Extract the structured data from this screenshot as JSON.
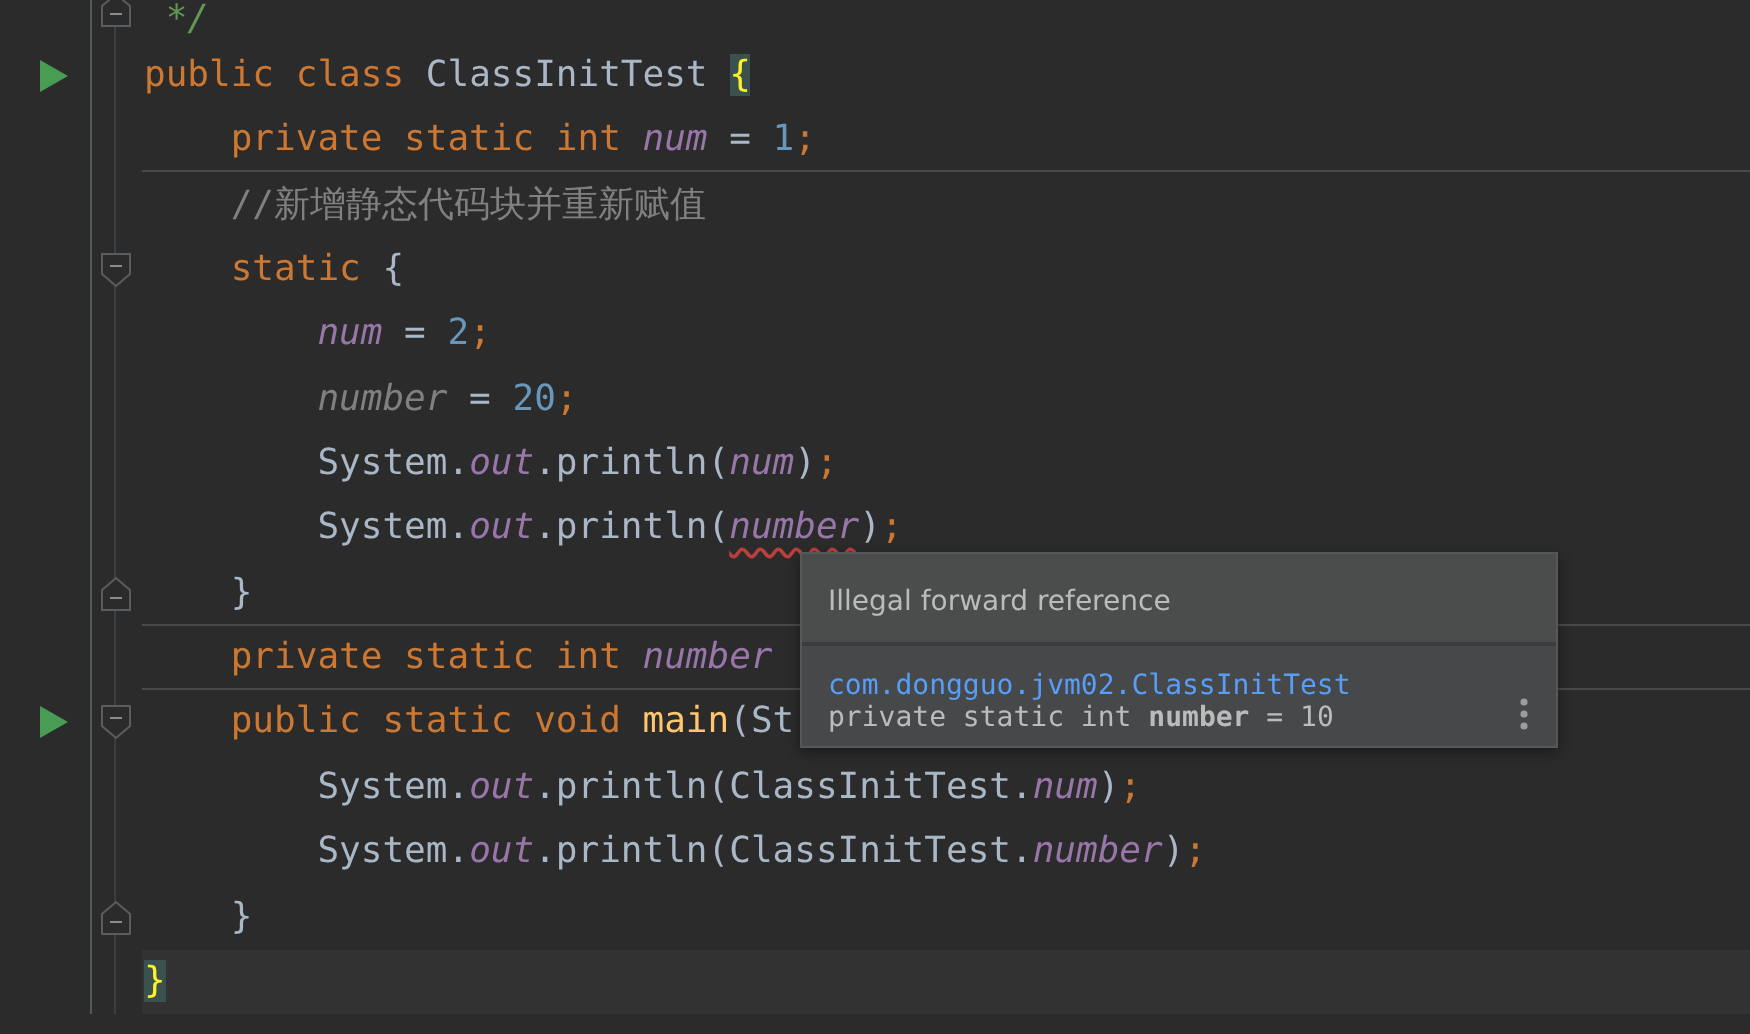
{
  "editor": {
    "lines": [
      {
        "fold_close": true,
        "tokens": [
          {
            "kind": "comment-doc",
            "text": " */"
          }
        ]
      },
      {
        "run": true,
        "tokens": [
          {
            "kind": "keyword",
            "text": "public class "
          },
          {
            "kind": "plain",
            "text": "ClassInitTest "
          },
          {
            "kind": "brace-match",
            "text": "{"
          }
        ]
      },
      {
        "separator": true,
        "tokens": [
          {
            "kind": "keyword",
            "text": "    private static int "
          },
          {
            "kind": "field",
            "text": "num"
          },
          {
            "kind": "plain",
            "text": " = "
          },
          {
            "kind": "number",
            "text": "1"
          },
          {
            "kind": "punct",
            "text": ";"
          }
        ]
      },
      {
        "tokens": [
          {
            "kind": "comment",
            "text": "    //新增静态代码块并重新赋值"
          }
        ]
      },
      {
        "fold_open": true,
        "tokens": [
          {
            "kind": "keyword",
            "text": "    static "
          },
          {
            "kind": "plain",
            "text": "{"
          }
        ]
      },
      {
        "tokens": [
          {
            "kind": "field",
            "text": "        num"
          },
          {
            "kind": "plain",
            "text": " = "
          },
          {
            "kind": "number",
            "text": "2"
          },
          {
            "kind": "punct",
            "text": ";"
          }
        ]
      },
      {
        "tokens": [
          {
            "kind": "unused",
            "text": "        number"
          },
          {
            "kind": "plain",
            "text": " = "
          },
          {
            "kind": "number",
            "text": "20"
          },
          {
            "kind": "punct",
            "text": ";"
          }
        ]
      },
      {
        "tokens": [
          {
            "kind": "plain",
            "text": "        System."
          },
          {
            "kind": "field",
            "text": "out"
          },
          {
            "kind": "plain",
            "text": ".println("
          },
          {
            "kind": "field",
            "text": "num"
          },
          {
            "kind": "plain",
            "text": ")"
          },
          {
            "kind": "punct",
            "text": ";"
          }
        ]
      },
      {
        "tokens": [
          {
            "kind": "plain",
            "text": "        System."
          },
          {
            "kind": "field",
            "text": "out"
          },
          {
            "kind": "plain",
            "text": ".println("
          },
          {
            "kind": "field",
            "text": "number",
            "error": true
          },
          {
            "kind": "plain",
            "text": ")"
          },
          {
            "kind": "punct",
            "text": ";"
          }
        ]
      },
      {
        "fold_close": true,
        "separator": true,
        "tokens": [
          {
            "kind": "plain",
            "text": "    }"
          }
        ]
      },
      {
        "separator": true,
        "tokens": [
          {
            "kind": "keyword",
            "text": "    private static int "
          },
          {
            "kind": "field",
            "text": "number"
          }
        ]
      },
      {
        "run": true,
        "fold_open": true,
        "tokens": [
          {
            "kind": "keyword",
            "text": "    public static void "
          },
          {
            "kind": "method",
            "text": "main"
          },
          {
            "kind": "plain",
            "text": "(St"
          }
        ]
      },
      {
        "tokens": [
          {
            "kind": "plain",
            "text": "        System."
          },
          {
            "kind": "field",
            "text": "out"
          },
          {
            "kind": "plain",
            "text": ".println(ClassInitTest."
          },
          {
            "kind": "field",
            "text": "num"
          },
          {
            "kind": "plain",
            "text": ")"
          },
          {
            "kind": "punct",
            "text": ";"
          }
        ]
      },
      {
        "tokens": [
          {
            "kind": "plain",
            "text": "        System."
          },
          {
            "kind": "field",
            "text": "out"
          },
          {
            "kind": "plain",
            "text": ".println(ClassInitTest."
          },
          {
            "kind": "field",
            "text": "number"
          },
          {
            "kind": "plain",
            "text": ")"
          },
          {
            "kind": "punct",
            "text": ";"
          }
        ]
      },
      {
        "fold_close": true,
        "tokens": [
          {
            "kind": "plain",
            "text": "    }"
          }
        ]
      },
      {
        "current": true,
        "tokens": [
          {
            "kind": "brace-match",
            "text": "}"
          }
        ]
      }
    ]
  },
  "tooltip": {
    "message": "Illegal forward reference",
    "link": "com.dongguo.jvm02.ClassInitTest",
    "declaration": "private static int **number** = 10"
  }
}
